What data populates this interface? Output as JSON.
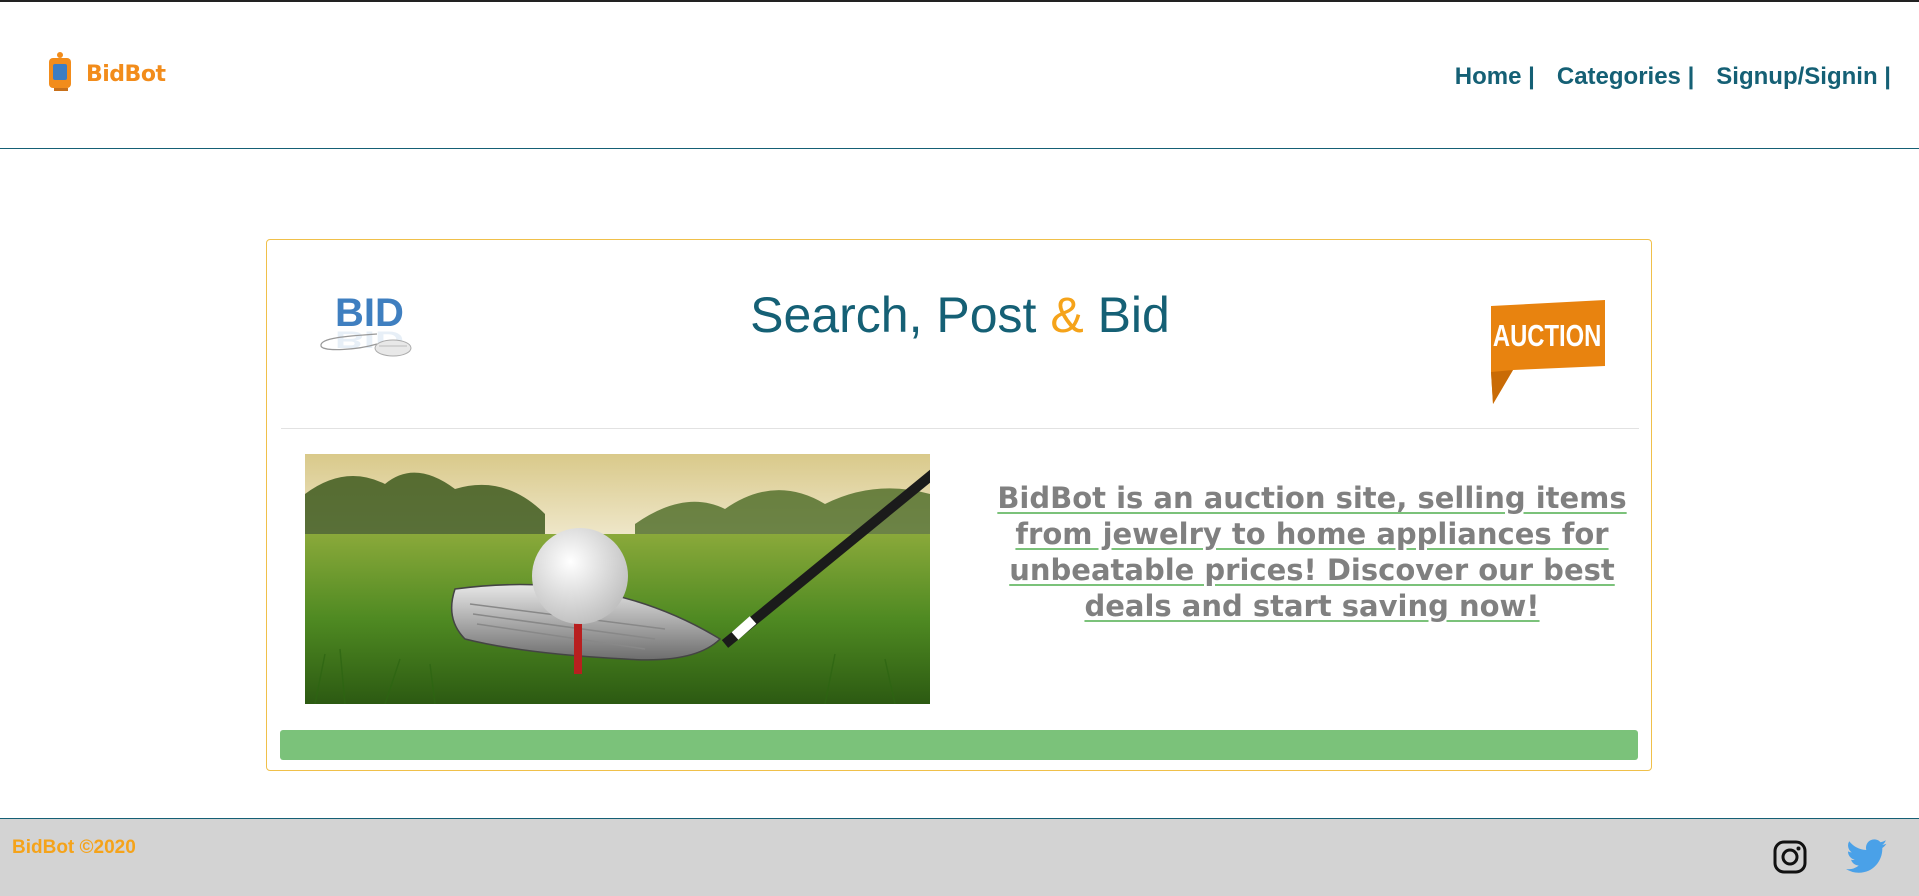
{
  "brand": {
    "logo_text": "BidBot"
  },
  "nav": {
    "items": [
      "Home |",
      "Categories |",
      "Signup/Signin |"
    ]
  },
  "card": {
    "title_part1": "Search, Post",
    "title_amp": "&",
    "title_part2": "Bid",
    "bid_logo_text": "BID",
    "auction_tag_text": "AUCTION",
    "description": "BidBot is an auction site, selling items from jewelry to home appliances for unbeatable prices! Discover our best deals and start saving now!"
  },
  "footer": {
    "copyright": "BidBot ©2020",
    "social_icons": [
      "instagram-icon",
      "twitter-icon"
    ]
  },
  "colors": {
    "primary": "#156075",
    "accent": "#f5a31a",
    "green": "#7bc27a",
    "footer_bg": "#d3d3d3"
  }
}
